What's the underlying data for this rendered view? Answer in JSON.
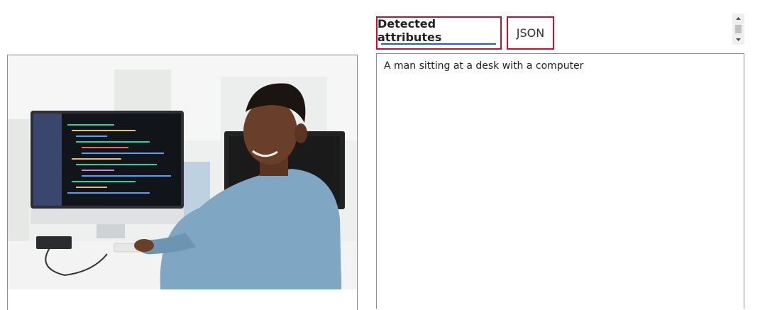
{
  "tabs": {
    "detected_attributes": "Detected attributes",
    "json": "JSON"
  },
  "output": {
    "caption": "A man sitting at a desk with a computer"
  },
  "colors": {
    "tab_highlight": "#c8102e",
    "active_underline": "#0f6cbd"
  }
}
